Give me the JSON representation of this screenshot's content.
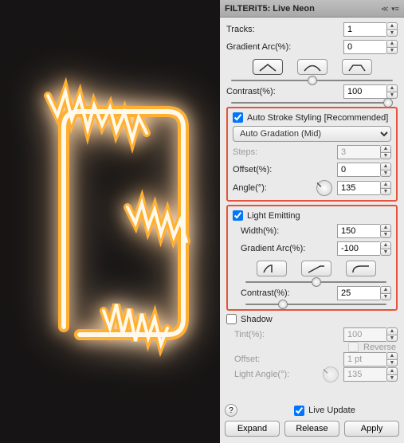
{
  "panel": {
    "title": "FILTERiT5: Live Neon",
    "tracks": {
      "label": "Tracks:",
      "value": "1"
    },
    "gradientArc": {
      "label": "Gradient Arc(%):",
      "value": "0",
      "slider": 50
    },
    "contrast": {
      "label": "Contrast(%):",
      "value": "100",
      "slider": 100
    },
    "autoStroke": {
      "checked": true,
      "label": "Auto Stroke Styling [Recommended]"
    },
    "gradationSelect": "Auto Gradation  (Mid)",
    "steps": {
      "label": "Steps:",
      "value": "3"
    },
    "offset": {
      "label": "Offset(%):",
      "value": "0"
    },
    "angle": {
      "label": "Angle(°):",
      "value": "135"
    },
    "lightEmitting": {
      "checked": true,
      "label": "Light Emitting",
      "width": {
        "label": "Width(%):",
        "value": "150"
      },
      "gradientArc": {
        "label": "Gradient Arc(%):",
        "value": "-100",
        "slider": 50
      },
      "contrast": {
        "label": "Contrast(%):",
        "value": "25",
        "slider": 25
      }
    },
    "shadow": {
      "checked": false,
      "label": "Shadow",
      "tint": {
        "label": "Tint(%):",
        "value": "100"
      },
      "reverse": {
        "checked": false,
        "label": "Reverse"
      },
      "offset": {
        "label": "Offset:",
        "value": "1 pt"
      },
      "lightAngle": {
        "label": "Light Angle(°):",
        "value": "135"
      }
    },
    "liveUpdate": {
      "checked": true,
      "label": "Live Update"
    },
    "buttons": {
      "expand": "Expand",
      "release": "Release",
      "apply": "Apply"
    }
  }
}
